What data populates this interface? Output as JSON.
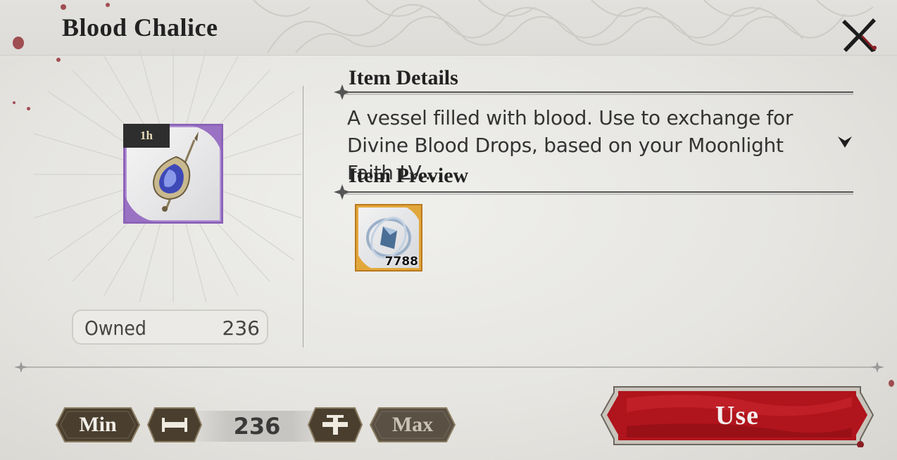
{
  "header": {
    "title": "Blood Chalice",
    "close_icon": "close-x-icon"
  },
  "item": {
    "icon": "blood-chalice-vial-icon",
    "timer_badge": "1h",
    "frame_color": "#8c63b8",
    "owned_label": "Owned",
    "owned_value": "236"
  },
  "details": {
    "title": "Item Details",
    "description": "A vessel filled with blood. Use to exchange for Divine Blood Drops, based on your Moonlight Faith LV....",
    "expand_icon": "chevron-down-icon"
  },
  "preview": {
    "title": "Item Preview",
    "items": [
      {
        "icon": "divine-blood-drop-crystal-icon",
        "count": "7788",
        "frame_color": "#e2a73c"
      }
    ]
  },
  "controls": {
    "min_label": "Min",
    "decrease_icon": "minus-icon",
    "quantity": "236",
    "increase_icon": "plus-icon",
    "max_label": "Max",
    "use_label": "Use",
    "use_color": "#b0141c"
  }
}
